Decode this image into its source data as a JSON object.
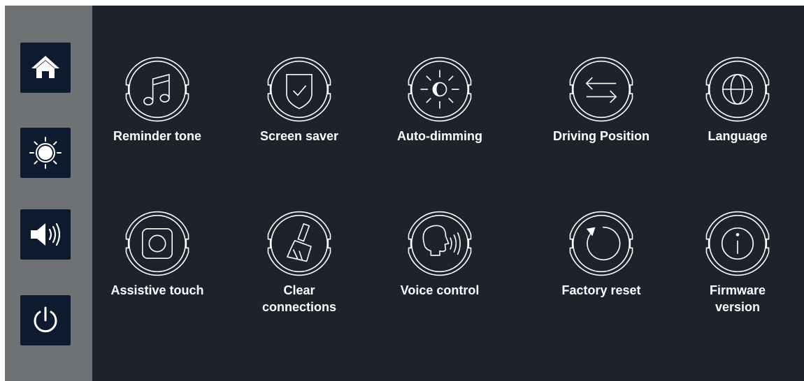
{
  "sidebar": {
    "items": [
      {
        "name": "home",
        "icon": "home-icon"
      },
      {
        "name": "brightness",
        "icon": "brightness-icon"
      },
      {
        "name": "volume",
        "icon": "volume-icon"
      },
      {
        "name": "power",
        "icon": "power-icon"
      }
    ]
  },
  "settings": {
    "row1": [
      {
        "label": "Reminder tone",
        "icon": "music-note-icon"
      },
      {
        "label": "Screen saver",
        "icon": "shield-check-icon"
      },
      {
        "label": "Auto-dimming",
        "icon": "auto-dimming-icon"
      },
      {
        "label": "Driving Position",
        "icon": "swap-arrows-icon"
      },
      {
        "label": "Language",
        "icon": "globe-icon"
      }
    ],
    "row2": [
      {
        "label": "Assistive touch",
        "icon": "assistive-touch-icon"
      },
      {
        "label": "Clear\nconnections",
        "icon": "broom-icon"
      },
      {
        "label": "Voice control",
        "icon": "voice-icon"
      },
      {
        "label": "Factory reset",
        "icon": "reset-icon"
      },
      {
        "label": "Firmware\nversion",
        "icon": "info-icon"
      }
    ]
  },
  "colors": {
    "panel_background": "#1e222b",
    "sidebar_background": "#6f7275",
    "sidebar_button": "#0e1a2e",
    "foreground": "#ffffff"
  }
}
